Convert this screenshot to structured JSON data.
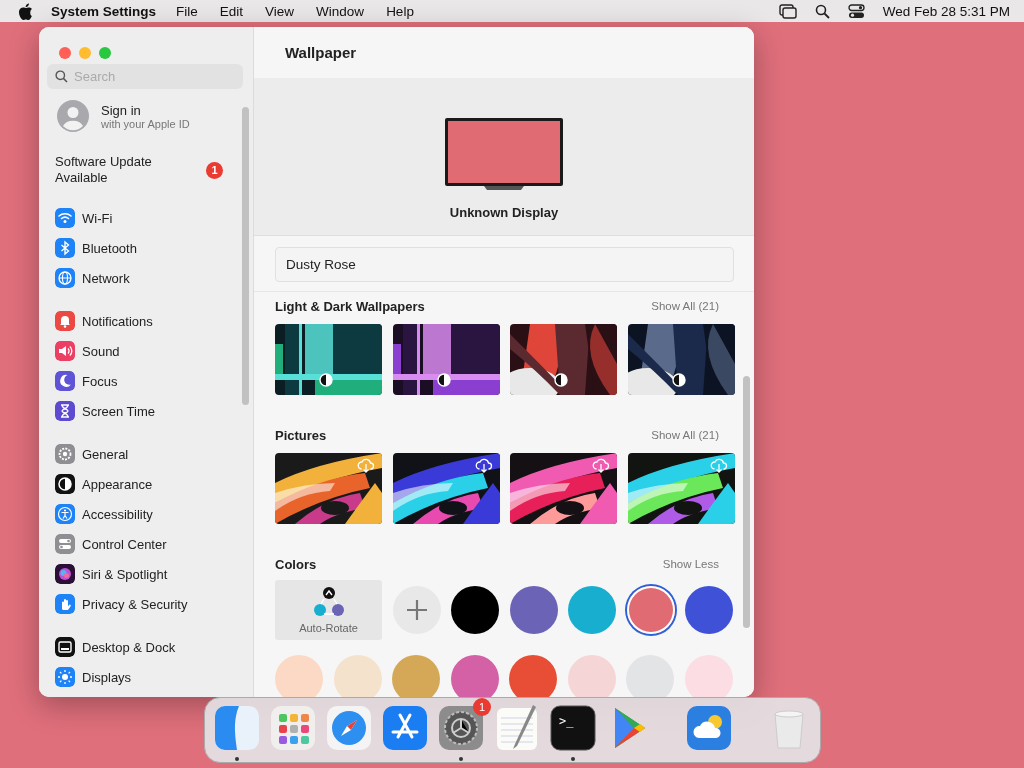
{
  "menubar": {
    "app_name": "System Settings",
    "menus": [
      "File",
      "Edit",
      "View",
      "Window",
      "Help"
    ],
    "clock": "Wed Feb 28  5:31 PM"
  },
  "sidebar": {
    "search": {
      "placeholder": "Search"
    },
    "account": {
      "title": "Sign in",
      "subtitle": "with your Apple ID"
    },
    "update": {
      "label": "Software Update Available",
      "badge": "1"
    },
    "groups": [
      {
        "items": [
          {
            "label": "Wi-Fi",
            "color": "#1e83f7",
            "selected": false
          },
          {
            "label": "Bluetooth",
            "color": "#1e83f7",
            "selected": false
          },
          {
            "label": "Network",
            "color": "#1e83f7",
            "selected": false
          }
        ]
      },
      {
        "items": [
          {
            "label": "Notifications",
            "color": "#ea4a43",
            "selected": false
          },
          {
            "label": "Sound",
            "color": "#ec3f64",
            "selected": false
          },
          {
            "label": "Focus",
            "color": "#5f54d6",
            "selected": false
          },
          {
            "label": "Screen Time",
            "color": "#5c4bd0",
            "selected": false
          }
        ]
      },
      {
        "items": [
          {
            "label": "General",
            "color": "#8e8e93",
            "selected": false
          },
          {
            "label": "Appearance",
            "color": "#111111",
            "selected": false
          },
          {
            "label": "Accessibility",
            "color": "#1e83f7",
            "selected": false
          },
          {
            "label": "Control Center",
            "color": "#8e8e93",
            "selected": false
          },
          {
            "label": "Siri & Spotlight",
            "color": "#2b1035",
            "selected": false
          },
          {
            "label": "Privacy & Security",
            "color": "#1e83f7",
            "selected": false
          }
        ]
      },
      {
        "items": [
          {
            "label": "Desktop & Dock",
            "color": "#111111",
            "selected": false
          },
          {
            "label": "Displays",
            "color": "#1e83f7",
            "selected": false
          }
        ]
      }
    ]
  },
  "content": {
    "title": "Wallpaper",
    "display": {
      "name": "Unknown Display",
      "color": "#e06b73"
    },
    "current": {
      "value": "Dusty Rose"
    },
    "sections": [
      {
        "kind": "dynamic",
        "title": "Light & Dark Wallpapers",
        "action": "Show All (21)"
      },
      {
        "kind": "download",
        "title": "Pictures",
        "action": "Show All (21)"
      },
      {
        "kind": "colors",
        "title": "Colors",
        "action": "Show Less",
        "auto_rotate": {
          "label": "Auto-Rotate"
        },
        "swatches": [
          {
            "color": "#000000",
            "selected": false
          },
          {
            "color": "#6b63b5",
            "selected": false
          },
          {
            "color": "#17aecf",
            "selected": false
          },
          {
            "color": "#e06b73",
            "selected": true
          },
          {
            "color": "#3f51d6",
            "selected": false
          },
          {
            "color": "#fcd9c4",
            "selected": false
          },
          {
            "color": "#f5e2cc",
            "selected": false
          },
          {
            "color": "#d4a857",
            "selected": false
          },
          {
            "color": "#d460a6",
            "selected": false
          },
          {
            "color": "#e84e35",
            "selected": false
          },
          {
            "color": "#f5d5d5",
            "selected": false
          },
          {
            "color": "#e2e4e6",
            "selected": false
          },
          {
            "color": "#fbdde3",
            "selected": false
          }
        ]
      }
    ]
  },
  "dock": {
    "items": [
      {
        "kind": "finder",
        "running": true
      },
      {
        "kind": "launchpad",
        "running": false
      },
      {
        "kind": "safari",
        "running": false
      },
      {
        "kind": "appstore",
        "running": false
      },
      {
        "kind": "settings",
        "running": true,
        "badge": "1"
      },
      {
        "kind": "textedit",
        "running": false
      },
      {
        "kind": "terminal",
        "running": true,
        "label": ">_"
      },
      {
        "kind": "play",
        "running": false
      },
      {
        "kind": "separator"
      },
      {
        "kind": "weather",
        "running": false
      },
      {
        "kind": "separator"
      },
      {
        "kind": "trash",
        "running": false
      }
    ]
  }
}
